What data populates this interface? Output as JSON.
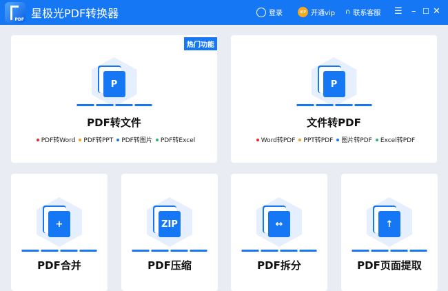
{
  "app": {
    "title": "星极光PDF转换器",
    "logo_text": "PDF"
  },
  "header": {
    "login": "登录",
    "vip_badge": "VIP",
    "vip": "开通vip",
    "support": "联系客服"
  },
  "colors": {
    "accent": "#1677f5",
    "red": "#f5222d",
    "orange": "#fa9c1b",
    "blue": "#1677f5",
    "green": "#2bb673"
  },
  "cards": [
    {
      "title": "PDF转文件",
      "badge": "热门功能",
      "icon": "P",
      "subs": [
        {
          "label": "PDF转Word",
          "color": "#f5222d"
        },
        {
          "label": "PDF转PPT",
          "color": "#fa9c1b"
        },
        {
          "label": "PDF转图片",
          "color": "#1677f5"
        },
        {
          "label": "PDF转Excel",
          "color": "#2bb673"
        }
      ]
    },
    {
      "title": "文件转PDF",
      "icon": "P",
      "subs": [
        {
          "label": "Word转PDF",
          "color": "#f5222d"
        },
        {
          "label": "PPT转PDF",
          "color": "#fa9c1b"
        },
        {
          "label": "图片转PDF",
          "color": "#1677f5"
        },
        {
          "label": "Excel转PDF",
          "color": "#2bb673"
        }
      ]
    },
    {
      "title": "PDF合并",
      "icon": "+"
    },
    {
      "title": "PDF压缩",
      "icon": "ZIP"
    },
    {
      "title": "PDF拆分",
      "icon": "↔"
    },
    {
      "title": "PDF页面提取",
      "icon": "↑"
    }
  ]
}
